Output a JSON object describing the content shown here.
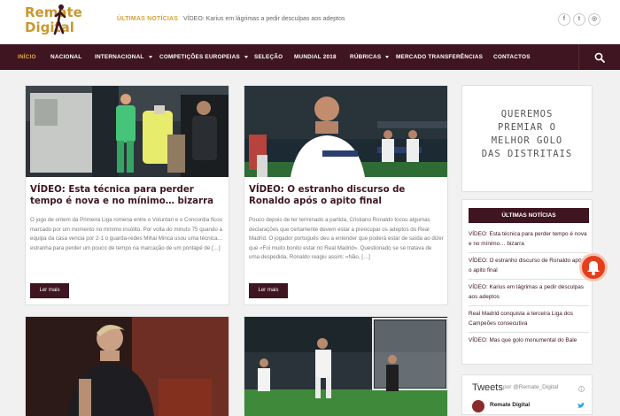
{
  "header": {
    "logo_line1": "Remate",
    "logo_line2": "Digital",
    "ticker_label": "ÚLTIMAS NOTÍCIAS",
    "ticker_text": "VÍDEO: Karius em lágrimas a pedir desculpas aos adeptos",
    "social": [
      "f",
      "t",
      "◎"
    ]
  },
  "nav": {
    "items": [
      {
        "label": "INÍCIO",
        "active": true
      },
      {
        "label": "NACIONAL"
      },
      {
        "label": "INTERNACIONAL",
        "dropdown": true
      },
      {
        "label": "COMPETIÇÕES EUROPEIAS",
        "dropdown": true
      },
      {
        "label": "SELEÇÃO"
      },
      {
        "label": "MUNDIAL 2018"
      },
      {
        "label": "RÚBRICAS",
        "dropdown": true
      },
      {
        "label": "MERCADO TRANSFERÊNCIAS"
      },
      {
        "label": "CONTACTOS"
      }
    ],
    "search_icon": "search-icon"
  },
  "posts": [
    {
      "title": "VÍDEO: Esta técnica para perder tempo é nova e no mínimo… bizarra",
      "excerpt": "O jogo de ontem da Primeira Liga romena entre o Voluntari e o Concordia ficou marcado por um momento no mínimo insólito. Por volta do minuto 75 quando a equipa da casa vencia por 2-1 o guarda-redes Mihai Minca usou uma técnica… estranha para perder um pouco de tempo na marcação de um pontapé de […]",
      "button": "Ler mais"
    },
    {
      "title": "VÍDEO: O estranho discurso de Ronaldo após o apito final",
      "excerpt": "Pouco depois de ter terminado a partida, Cristiano Ronaldo tocou algumas declarações que certamente devem estar a preocupar os adeptos do Real Madrid. O jogador português deu a entender que poderá estar de saída ao dizer que «Foi muito bonito estar no Real Madrid». Questionado se se tratava de uma despedida, Ronaldo reagiu assim: «Não, […]",
      "button": "Ler mais"
    }
  ],
  "sidebar": {
    "promo": [
      "QUEREMOS",
      "PREMIAR O",
      "MELHOR GOLO",
      "DAS DISTRITAIS"
    ],
    "latest_title": "ÚLTIMAS NOTÍCIAS",
    "latest": [
      "VÍDEO: Esta técnica para perder tempo é nova e no mínimo… bizarra",
      "VÍDEO: O estranho discurso de Ronaldo após o apito final",
      "VÍDEO: Karius em lágrimas a pedir desculpas aos adeptos",
      "Real Madrid conquista a terceira Liga dos Campeões consecutiva",
      "VÍDEO: Mas que golo monumental do Bale"
    ],
    "tweets_title": "Tweets",
    "tweets_by": "por @Remate_Digital",
    "tweet_user": "Remate Digital"
  },
  "colors": {
    "brand": "#3e1520",
    "accent": "#c9982f",
    "bell": "#e63e1c"
  }
}
